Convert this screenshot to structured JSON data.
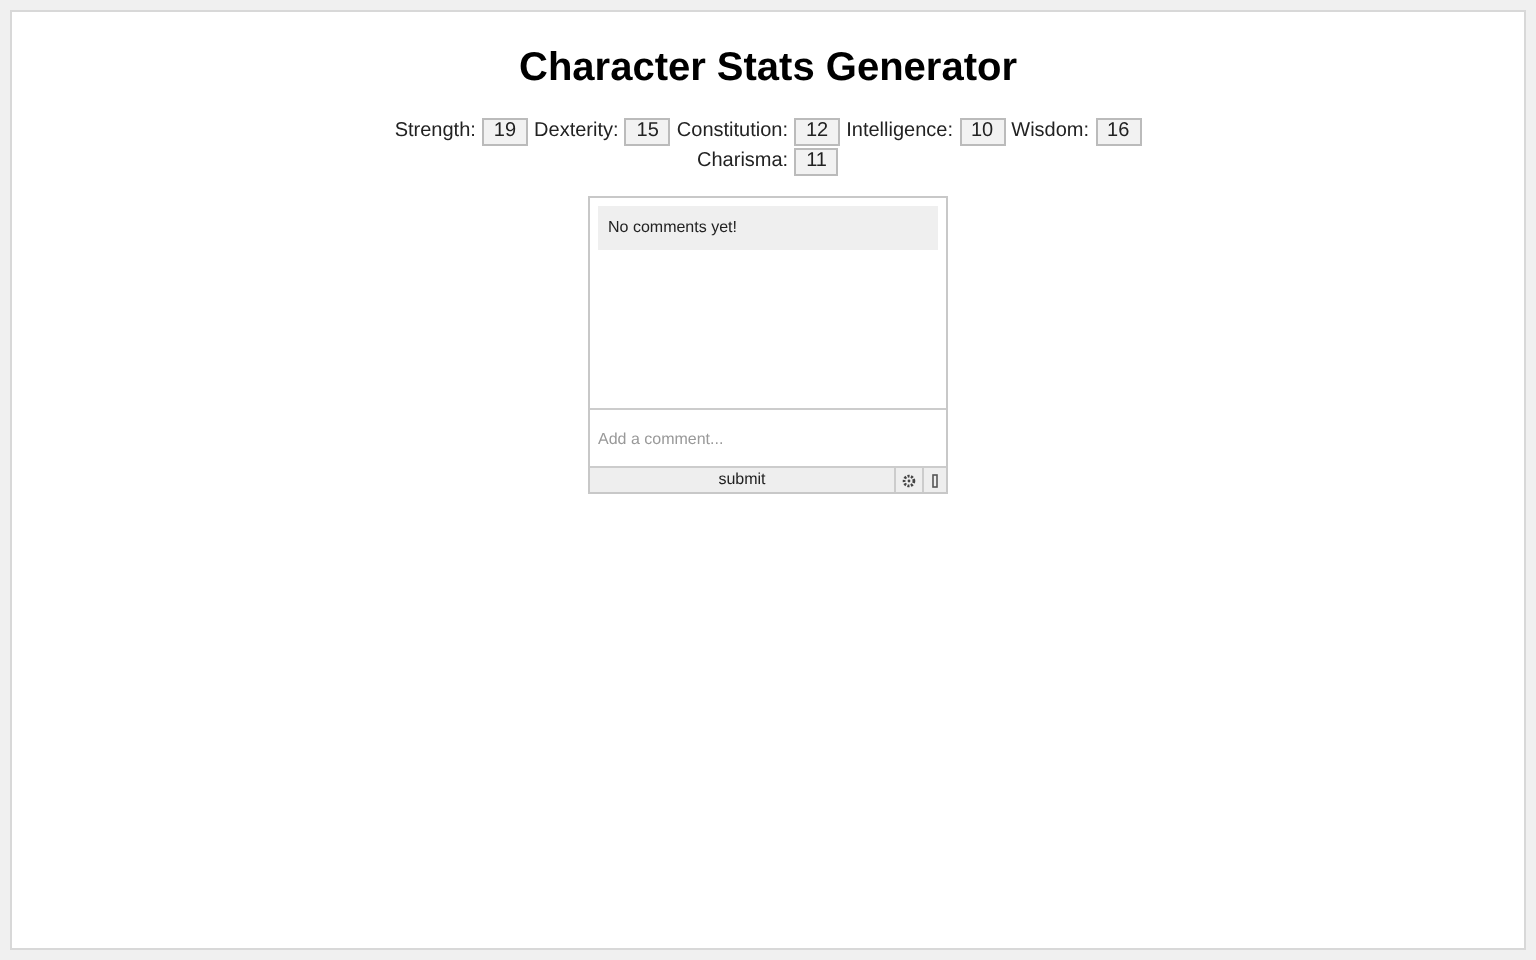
{
  "title": "Character Stats Generator",
  "stats": [
    {
      "label": "Strength:",
      "value": "19"
    },
    {
      "label": "Dexterity:",
      "value": "15"
    },
    {
      "label": "Constitution:",
      "value": "12"
    },
    {
      "label": "Intelligence:",
      "value": "10"
    },
    {
      "label": "Wisdom:",
      "value": "16"
    },
    {
      "label": "Charisma:",
      "value": "11"
    }
  ],
  "comments": {
    "empty_message": "No comments yet!",
    "placeholder": "Add a comment...",
    "submit": "submit"
  }
}
